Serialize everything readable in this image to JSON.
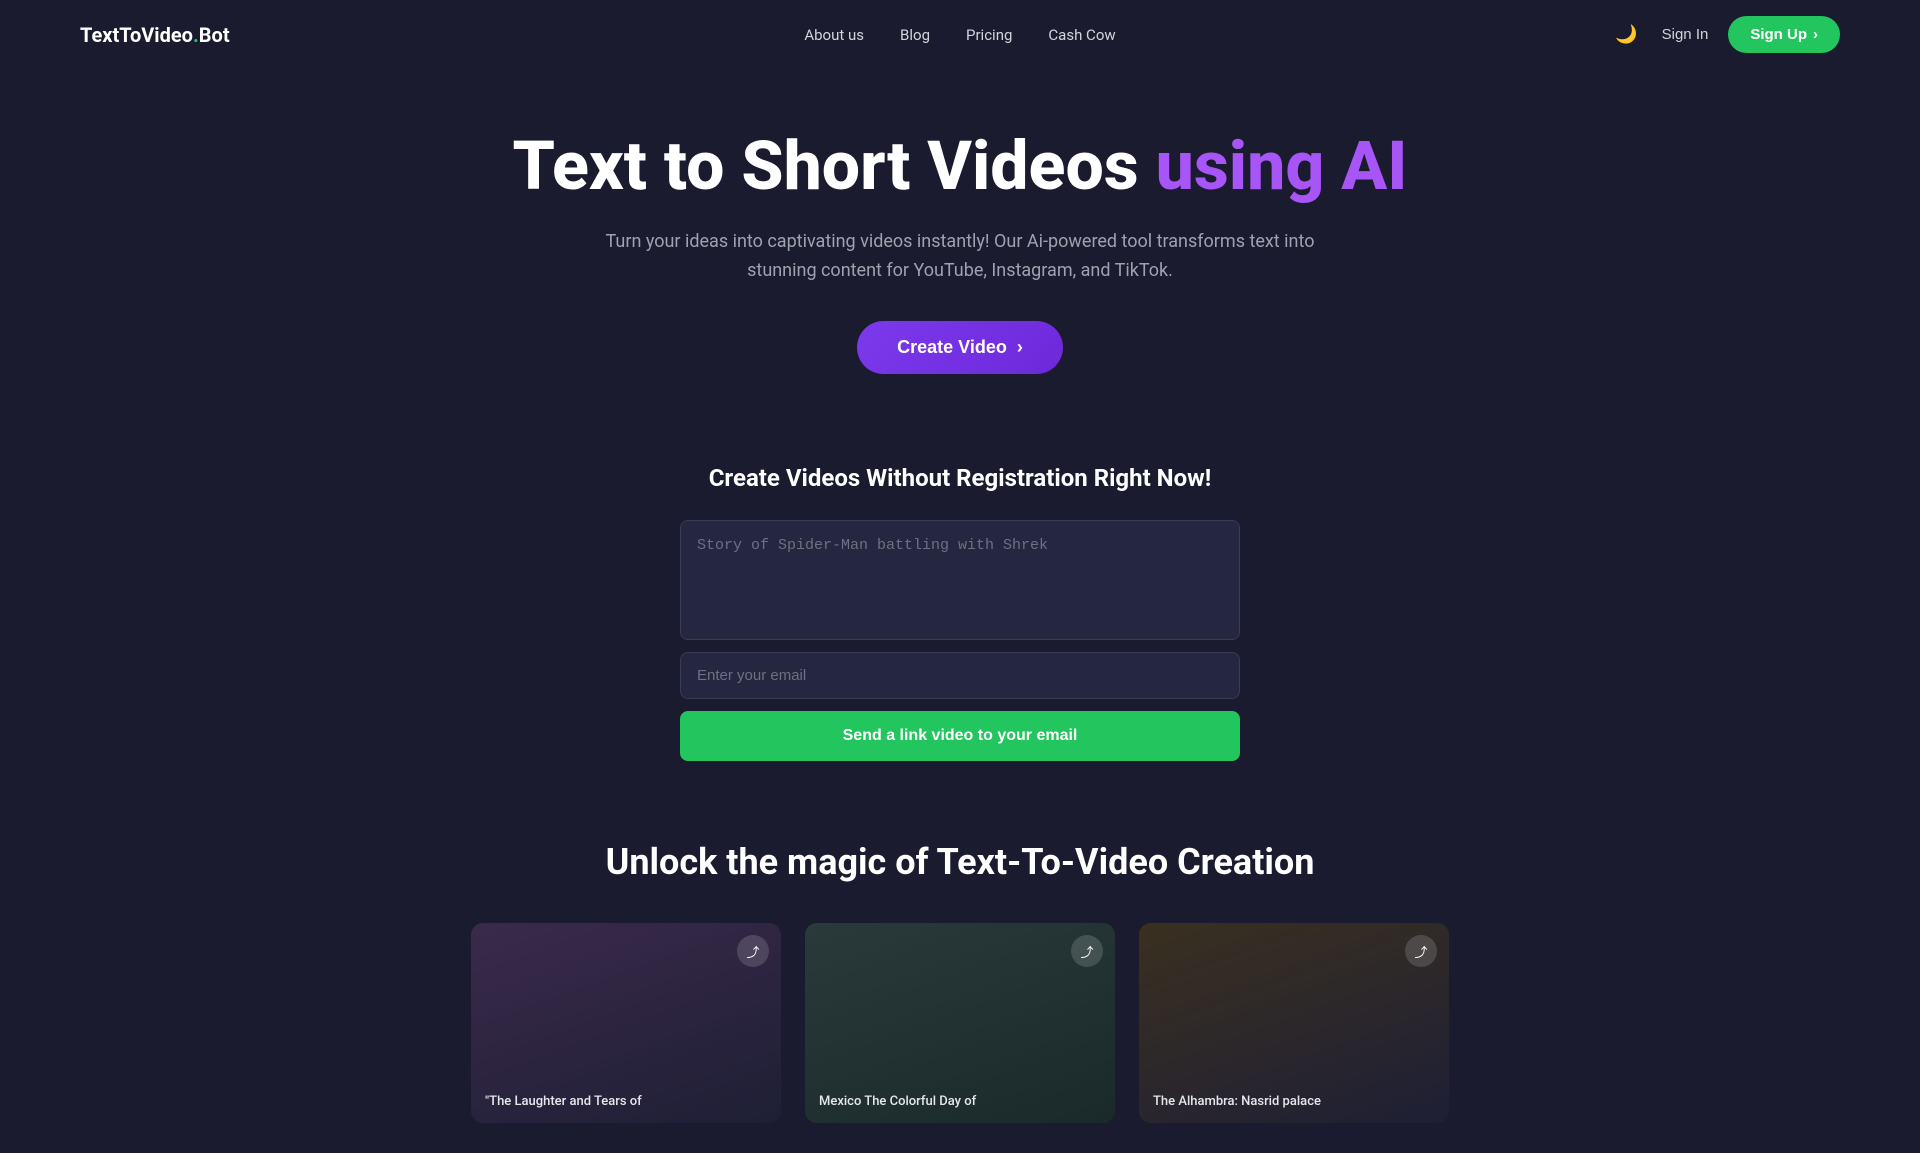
{
  "brand": {
    "name": "TextToVideo",
    "dot": ".",
    "suffix": "Bot"
  },
  "nav": {
    "links": [
      {
        "label": "About us",
        "id": "about-us"
      },
      {
        "label": "Blog",
        "id": "blog"
      },
      {
        "label": "Pricing",
        "id": "pricing"
      },
      {
        "label": "Cash Cow",
        "id": "cash-cow"
      }
    ],
    "sign_in_label": "Sign In",
    "sign_up_label": "Sign Up",
    "theme_icon": "🌙"
  },
  "hero": {
    "title_start": "Text to Short Videos ",
    "title_highlight": "using AI",
    "subtitle": "Turn your ideas into captivating videos instantly! Our Ai-powered tool transforms text into stunning content for YouTube, Instagram, and TikTok.",
    "cta_label": "Create Video"
  },
  "form_section": {
    "title": "Create Videos Without Registration Right Now!",
    "textarea_placeholder": "Story of Spider-Man battling with Shrek",
    "email_placeholder": "Enter your email",
    "submit_label": "Send a link video to your email"
  },
  "magic_section": {
    "title": "Unlock the magic of Text-To-Video Creation",
    "cards": [
      {
        "label": "\"The Laughter and Tears of",
        "id": "card-1"
      },
      {
        "label": "Mexico The Colorful Day of",
        "id": "card-2"
      },
      {
        "label": "The Alhambra: Nasrid palace",
        "id": "card-3"
      }
    ]
  }
}
